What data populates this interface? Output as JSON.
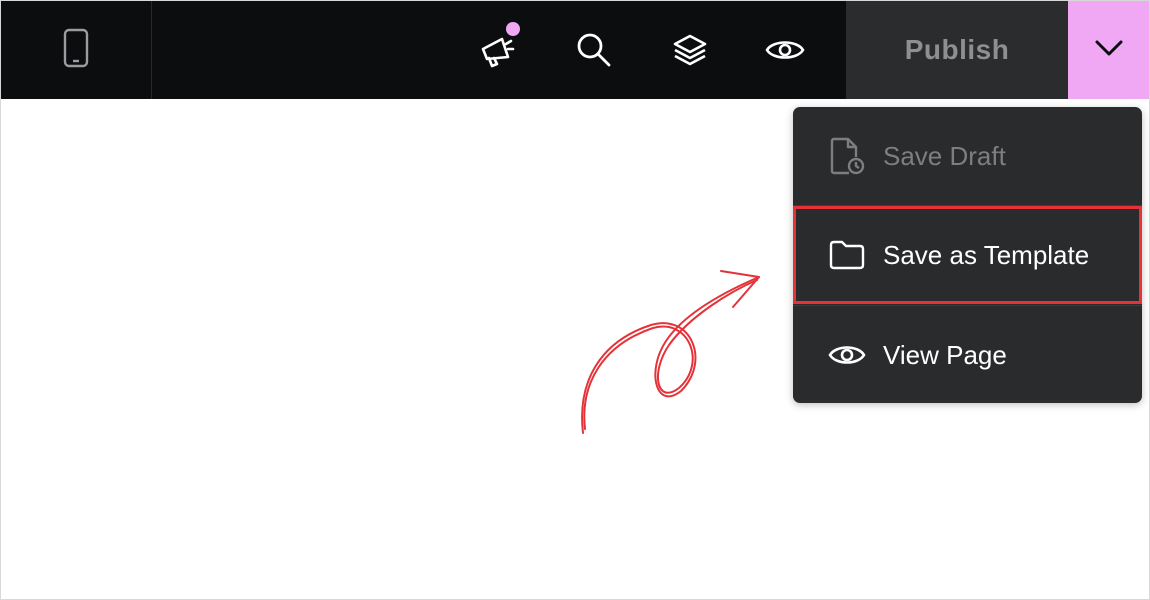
{
  "colors": {
    "accent": "#f0a8f4",
    "notification_dot": "#f0a8f4",
    "highlight_outline": "#e53238",
    "annotation_arrow": "#e53238"
  },
  "toolbar": {
    "device_icon": "smartphone-icon",
    "tools": [
      {
        "name": "announcements",
        "icon": "megaphone-icon",
        "has_notification": true
      },
      {
        "name": "search",
        "icon": "search-icon"
      },
      {
        "name": "layers",
        "icon": "layers-icon"
      },
      {
        "name": "preview",
        "icon": "eye-icon"
      }
    ],
    "publish_label": "Publish",
    "dropdown_icon": "chevron-down-icon"
  },
  "publish_menu": {
    "items": [
      {
        "label": "Save Draft",
        "icon": "file-clock-icon",
        "disabled": true
      },
      {
        "label": "Save as Template",
        "icon": "folder-icon",
        "highlighted": true
      },
      {
        "label": "View Page",
        "icon": "eye-icon"
      }
    ]
  }
}
